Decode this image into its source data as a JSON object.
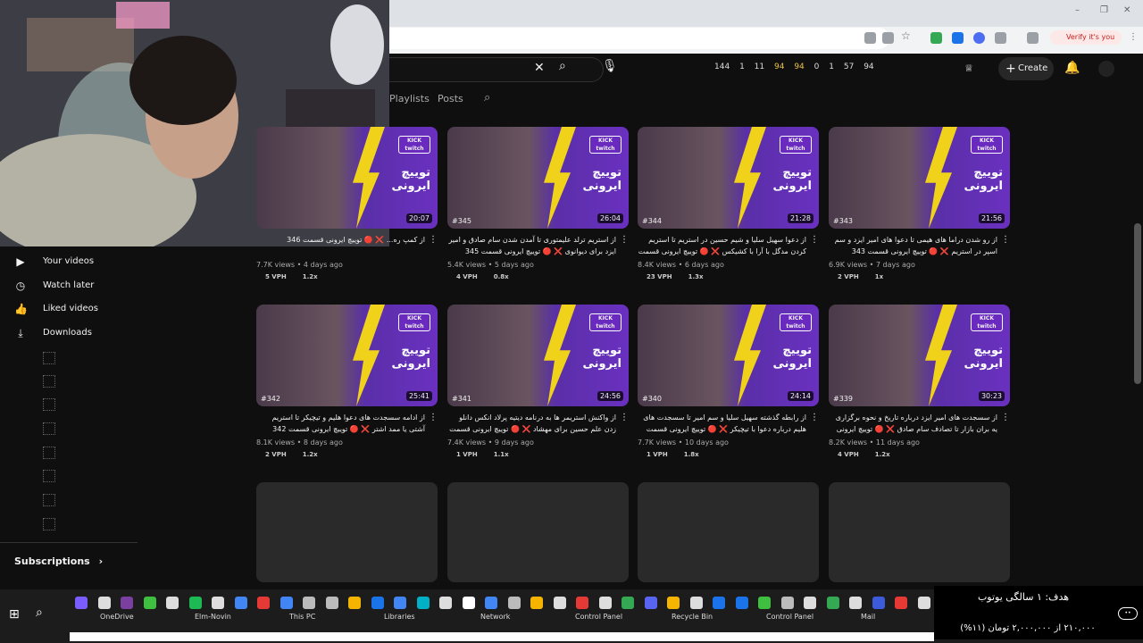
{
  "browser": {
    "verify_label": "Verify it's you"
  },
  "yt_header": {
    "stats": [
      "144",
      "1",
      "11",
      "94",
      "94",
      "0",
      "1",
      "57",
      "94"
    ],
    "create_label": "Create"
  },
  "tabs": [
    "Playlists",
    "Posts"
  ],
  "sidebar": {
    "items": [
      {
        "icon": "your-videos-icon",
        "label": "Your videos"
      },
      {
        "icon": "watch-later-icon",
        "label": "Watch later"
      },
      {
        "icon": "liked-videos-icon",
        "label": "Liked videos"
      },
      {
        "icon": "downloads-icon",
        "label": "Downloads"
      }
    ],
    "subscriptions_label": "Subscriptions"
  },
  "videos": [
    {
      "title": "از کمپ ره... ❌ 🔴 توییچ ایرونی قسمت 346",
      "views": "7.7K views",
      "age": "4 days ago",
      "vph": "5 VPH",
      "ratio": "1.2x",
      "duration": "20:07",
      "ep": ""
    },
    {
      "title": "از استریم ترلد علیمتوری تا آمدن شدن سام صادق و امیر ایزد برای دیوانوی ❌ 🔴 توییچ ایرونی قسمت 345",
      "views": "5.4K views",
      "age": "5 days ago",
      "vph": "4 VPH",
      "ratio": "0.8x",
      "duration": "26:04",
      "ep": "#345"
    },
    {
      "title": "از دعوا سهیل سلیا و شیم حسین در استریم تا استریم کردن مدگل با آرا با کشیکس ❌ 🔴 توییچ ایرونی قسمت 344",
      "views": "8.4K views",
      "age": "6 days ago",
      "vph": "23 VPH",
      "ratio": "1.3x",
      "duration": "21:28",
      "ep": "#344"
    },
    {
      "title": "از رو شدن دراما های هیمی تا دعوا های امیر ایزد و سم اسپر در استریم ❌ 🔴 توییچ ایرونی قسمت 343",
      "views": "6.9K views",
      "age": "7 days ago",
      "vph": "2 VPH",
      "ratio": "1x",
      "duration": "21:56",
      "ep": "#343"
    },
    {
      "title": "از ادامه سسجدت های دعوا هلیم و تیچیکر تا استریم آشتی یا ممد اشتر ❌ 🔴 توییچ ایرونی قسمت 342",
      "views": "8.1K views",
      "age": "8 days ago",
      "vph": "2 VPH",
      "ratio": "1.2x",
      "duration": "25:41",
      "ep": "#342"
    },
    {
      "title": "از واکنش استریمر ها به درنامه دیتیه پرلاد انکس دانلو زدن علم حسین برای مهشاد ❌ 🔴 توییچ ایرونی قسمت 341",
      "views": "7.4K views",
      "age": "9 days ago",
      "vph": "1 VPH",
      "ratio": "1.1x",
      "duration": "24:56",
      "ep": "#341"
    },
    {
      "title": "از رابطه گذشته سهیل سلیا و سم امیر تا سسجدت های هلیم درباره دعوا با تیچیکر ❌ 🔴 توییچ ایرونی قسمت 340",
      "views": "7.7K views",
      "age": "10 days ago",
      "vph": "1 VPH",
      "ratio": "1.8x",
      "duration": "24:14",
      "ep": "#340"
    },
    {
      "title": "از سسجدت های امیر ایزد درباره تاریخ و نحوه برگزاری یه بران بازار تا تصادف سام صادق ❌ 🔴 توییچ ایرونی قسمت",
      "views": "8.2K views",
      "age": "11 days ago",
      "vph": "4 VPH",
      "ratio": "1.2x",
      "duration": "30:23",
      "ep": "#339"
    }
  ],
  "thumb_text": {
    "kick": "KICK",
    "twitch": "twitch",
    "brand": "توییچ ایرونی"
  },
  "taskbar": {
    "desktop_items": [
      "OneDrive",
      "Elm-Novin",
      "This PC",
      "Libraries",
      "Network",
      "Control Panel",
      "Recycle Bin",
      "Control Panel",
      "Mail"
    ]
  },
  "overlay": {
    "goal_line": "هدف: ۱ سالگی یوتوب",
    "progress_line": "۲۱۰,۰۰۰ از ۲,۰۰۰,۰۰۰ تومان (۱۱%)"
  }
}
